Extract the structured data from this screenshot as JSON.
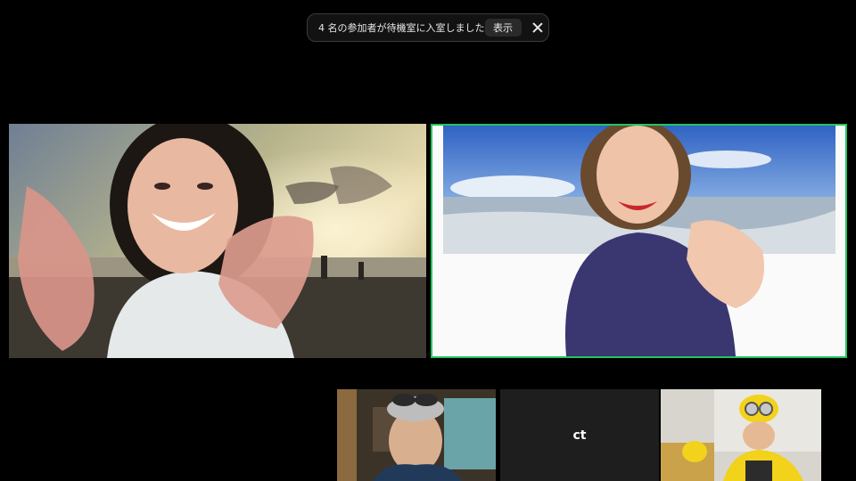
{
  "notification": {
    "message": "4 名の参加者が待機室に入室しました",
    "view_label": "表示",
    "close_icon": "close-icon"
  },
  "participants": [
    {
      "position": "main-left",
      "active_speaker": false
    },
    {
      "position": "main-right",
      "active_speaker": true
    },
    {
      "position": "thumbnail-1",
      "active_speaker": false
    },
    {
      "position": "thumbnail-2",
      "name_label": "ct",
      "active_speaker": false
    },
    {
      "position": "thumbnail-3",
      "active_speaker": false
    }
  ],
  "colors": {
    "background": "#000000",
    "active_speaker_border": "#22c55e",
    "notice_bg": "#121212",
    "placeholder_tile": "#1e1e1e"
  }
}
